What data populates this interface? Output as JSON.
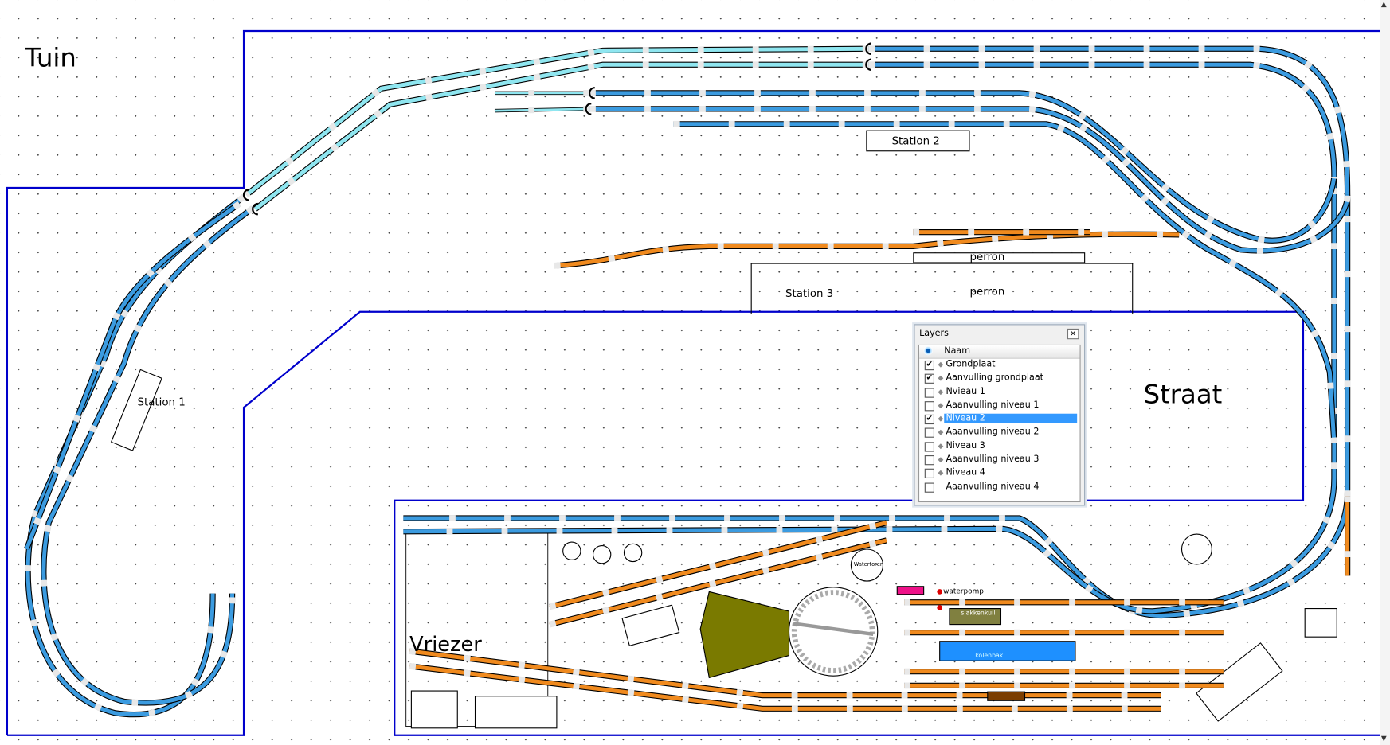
{
  "colors": {
    "boundary": "#0000cc",
    "track_blue": "#3b9be0",
    "track_cyan": "#8fe6f0",
    "track_orange": "#f08a1e",
    "tie": "#e8e8e8",
    "locloods": "#7a7a00",
    "kolenbak": "#1e90ff",
    "slakkenkuil": "#808040",
    "zand": "#ee1188",
    "pomp": "#dd0000",
    "brown": "#7a3d00"
  },
  "areas": {
    "tuin": "Tuin",
    "straat": "Straat",
    "vriezer": "Vriezer"
  },
  "stations": {
    "station1": "Station 1",
    "station2": "Station 2",
    "station3": "Station 3",
    "perron_small": "perron",
    "perron_large": "perron"
  },
  "yard": {
    "watertoren": "Watertoren",
    "waterpomp": "waterpomp",
    "slakkenkuil": "slakkenkuil",
    "kolenbak": "kolenbak"
  },
  "layers_panel": {
    "title": "Layers",
    "column": "Naam",
    "eye_icon": "eye-icon",
    "items": [
      {
        "label": "Grondplaat",
        "checked": true,
        "selected": false
      },
      {
        "label": "Aanvulling grondplaat",
        "checked": true,
        "selected": false
      },
      {
        "label": "Nvieau 1",
        "checked": false,
        "selected": false
      },
      {
        "label": "Aaanvulling niveau 1",
        "checked": false,
        "selected": false
      },
      {
        "label": "Niveau 2",
        "checked": true,
        "selected": true
      },
      {
        "label": "Aaanvulling niveau 2",
        "checked": false,
        "selected": false
      },
      {
        "label": "Niveau 3",
        "checked": false,
        "selected": false
      },
      {
        "label": "Aaanvulling niveau 3",
        "checked": false,
        "selected": false
      },
      {
        "label": "Niveau 4",
        "checked": false,
        "selected": false
      },
      {
        "label": "Aaanvulling niveau 4",
        "checked": false,
        "selected": false
      }
    ]
  }
}
